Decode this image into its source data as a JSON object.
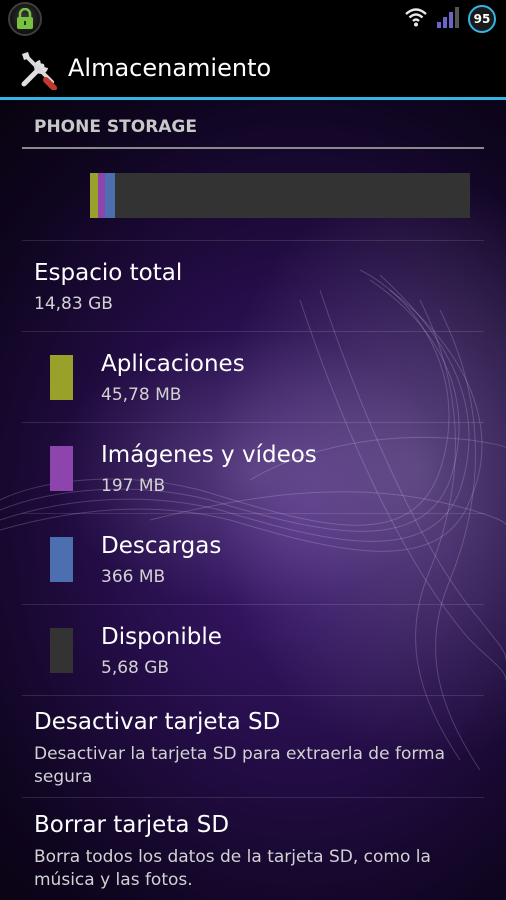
{
  "status_bar": {
    "battery_level": "95",
    "icons": [
      "lock-icon",
      "wifi-icon",
      "signal-icon",
      "battery-icon"
    ],
    "accent_color": "#33b5e5"
  },
  "action_bar": {
    "title": "Almacenamiento",
    "icon": "tools-icon"
  },
  "storage": {
    "section_header": "PHONE STORAGE",
    "usage_bar": {
      "segments": [
        {
          "label": "Aplicaciones",
          "fraction": 0.02,
          "color": "#99a12a"
        },
        {
          "label": "Imágenes y vídeos",
          "fraction": 0.02,
          "color": "#8e44ad"
        },
        {
          "label": "Descargas",
          "fraction": 0.025,
          "color": "#4c6fb0"
        }
      ],
      "background_color": "#333333"
    },
    "total": {
      "title": "Espacio total",
      "value": "14,83 GB"
    },
    "categories": [
      {
        "title": "Aplicaciones",
        "value": "45,78 MB",
        "color": "#99a12a"
      },
      {
        "title": "Imágenes y vídeos",
        "value": "197 MB",
        "color": "#8e44ad"
      },
      {
        "title": "Descargas",
        "value": "366 MB",
        "color": "#4c6fb0"
      },
      {
        "title": "Disponible",
        "value": "5,68 GB",
        "color": "#333333"
      }
    ],
    "actions": [
      {
        "title": "Desactivar tarjeta SD",
        "summary": "Desactivar la tarjeta SD para extraerla de forma segura"
      },
      {
        "title": "Borrar tarjeta SD",
        "summary": "Borra todos los datos de la tarjeta SD, como la música y las fotos."
      }
    ]
  }
}
